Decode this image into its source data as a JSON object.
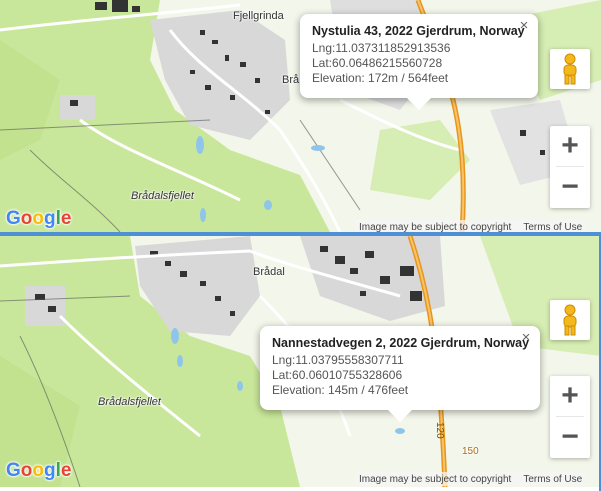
{
  "colors": {
    "terrain": "#c9e79a",
    "meadow": "#f3f6ea",
    "urban": "#d8d8d8",
    "highway": "#e8951c",
    "water": "#8fc5ea",
    "accent": "#4f8fd6"
  },
  "panels": [
    {
      "id": "top",
      "info": {
        "title": "Nystulia 43, 2022 Gjerdrum, Norway",
        "lng": "Lng:11.037311852913536",
        "lat": "Lat:60.06486215560728",
        "elevation": "Elevation: 172m / 564feet",
        "close": "×"
      },
      "places": [
        "Fjellgrinda",
        "Brå",
        "Brådalsfjellet"
      ],
      "logo": "Google",
      "attribution": {
        "imagery": "Image may be subject to copyright",
        "terms": "Terms of Use"
      },
      "zoom_in": "+",
      "zoom_out": "−",
      "icons": [
        "pegman-icon",
        "close-icon"
      ]
    },
    {
      "id": "bottom",
      "info": {
        "title": "Nannestadvegen 2, 2022 Gjerdrum, Norway",
        "lng": "Lng:11.03795558307711",
        "lat": "Lat:60.06010755328606",
        "elevation": "Elevation: 145m / 476feet",
        "close": "×"
      },
      "places": [
        "Brådal",
        "Brådalsfjellet"
      ],
      "road_number": "120",
      "contour_label": "150",
      "logo": "Google",
      "attribution": {
        "imagery": "Image may be subject to copyright",
        "terms": "Terms of Use"
      },
      "zoom_in": "+",
      "zoom_out": "−",
      "icons": [
        "pegman-icon",
        "close-icon"
      ]
    }
  ]
}
